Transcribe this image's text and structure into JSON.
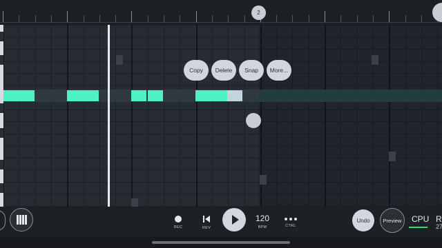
{
  "ruler": {
    "bar_marker": "2"
  },
  "context_menu": {
    "items": [
      "Copy",
      "Delete",
      "Snap",
      "More..."
    ]
  },
  "transport": {
    "rec_label": "REC",
    "rev_label": "REV",
    "bpm_value": "120",
    "bpm_label": "BPM",
    "ctrl_label": "CTRL"
  },
  "right_controls": {
    "undo_label": "Undo",
    "preview_label": "Preview",
    "cpu_label": "CPU",
    "cpu_level": 0.95,
    "r_label": "R",
    "r_value": "27"
  },
  "colors": {
    "note": "#4ff0c6",
    "selected_note": "#c4d3dc",
    "cpu_meter": "#45d96b"
  },
  "icons": [
    "record-icon",
    "rewind-icon",
    "play-icon",
    "more-dots-icon",
    "piano-keys-icon"
  ]
}
